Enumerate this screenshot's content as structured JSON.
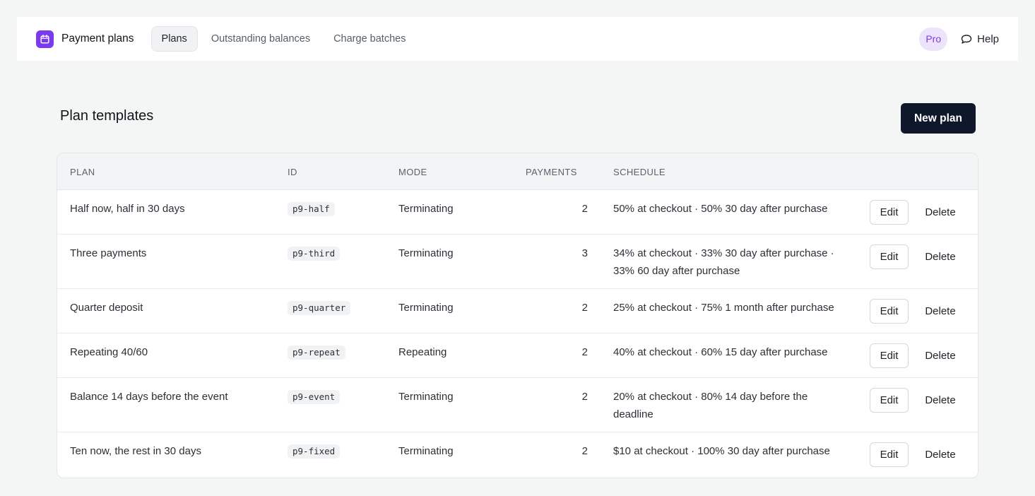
{
  "header": {
    "app_name": "Payment plans",
    "icon": "calendar-icon",
    "accent": "#7c3aed",
    "tabs": [
      {
        "label": "Plans",
        "active": true
      },
      {
        "label": "Outstanding balances",
        "active": false
      },
      {
        "label": "Charge batches",
        "active": false
      }
    ],
    "badge": "Pro",
    "help_label": "Help"
  },
  "page": {
    "title": "Plan templates",
    "new_button": "New plan"
  },
  "table": {
    "columns": {
      "plan": "PLAN",
      "id": "ID",
      "mode": "MODE",
      "payments": "PAYMENTS",
      "schedule": "SCHEDULE"
    },
    "rows": [
      {
        "plan": "Half now, half in 30 days",
        "id": "p9-half",
        "mode": "Terminating",
        "payments": "2",
        "schedule": "50% at checkout · 50% 30 day after purchase",
        "edit": "Edit",
        "delete": "Delete"
      },
      {
        "plan": "Three payments",
        "id": "p9-third",
        "mode": "Terminating",
        "payments": "3",
        "schedule": "34% at checkout · 33% 30 day after purchase · 33% 60 day after purchase",
        "edit": "Edit",
        "delete": "Delete"
      },
      {
        "plan": "Quarter deposit",
        "id": "p9-quarter",
        "mode": "Terminating",
        "payments": "2",
        "schedule": "25% at checkout · 75% 1 month after purchase",
        "edit": "Edit",
        "delete": "Delete"
      },
      {
        "plan": "Repeating 40/60",
        "id": "p9-repeat",
        "mode": "Repeating",
        "payments": "2",
        "schedule": "40% at checkout · 60% 15 day after purchase",
        "edit": "Edit",
        "delete": "Delete"
      },
      {
        "plan": "Balance 14 days before the event",
        "id": "p9-event",
        "mode": "Terminating",
        "payments": "2",
        "schedule": "20% at checkout · 80% 14 day before the deadline",
        "edit": "Edit",
        "delete": "Delete"
      },
      {
        "plan": "Ten now, the rest in 30 days",
        "id": "p9-fixed",
        "mode": "Terminating",
        "payments": "2",
        "schedule": "$10 at checkout · 100% 30 day after purchase",
        "edit": "Edit",
        "delete": "Delete"
      }
    ]
  }
}
